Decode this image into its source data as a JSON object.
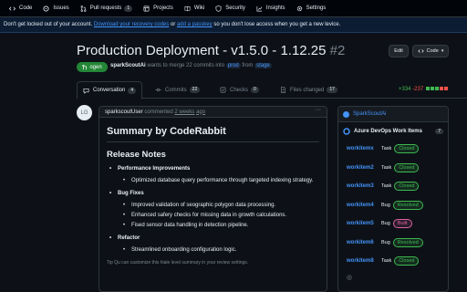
{
  "nav": {
    "items": [
      {
        "label": "Code",
        "icon": "code-icon",
        "count": ""
      },
      {
        "label": "Issues",
        "icon": "issue-icon",
        "count": ""
      },
      {
        "label": "Pull requests",
        "icon": "pull-request-icon",
        "count": "1"
      },
      {
        "label": "Projects",
        "icon": "table-icon",
        "count": ""
      },
      {
        "label": "Wiki",
        "icon": "book-icon",
        "count": ""
      },
      {
        "label": "Security",
        "icon": "shield-icon",
        "count": ""
      },
      {
        "label": "Insights",
        "icon": "graph-icon",
        "count": ""
      },
      {
        "label": "Settings",
        "icon": "gear-icon",
        "count": ""
      }
    ]
  },
  "banner": {
    "text1": "Don't get locked out of your account.",
    "link1": "Download your recovery codes",
    "text2": "or",
    "link2": "add a passkey",
    "text3": "so you don't lose access when you get a new levice."
  },
  "pr": {
    "title": "Production Deployment - v1.5.0 - 1.12.25",
    "number": "#2",
    "edit_label": "Edit",
    "code_label": "Code",
    "state_label": "ogen",
    "author": "sparkScoutAi",
    "merge_text": "wants to merge 22 commits into",
    "base_branch": "prod",
    "from_text": "from",
    "head_branch": "stage"
  },
  "tabs": [
    {
      "label": "Conversation",
      "count": "4",
      "icon": "comment-icon"
    },
    {
      "label": "Commits",
      "count": "22",
      "icon": "commit-icon"
    },
    {
      "label": "Checks",
      "count": "0",
      "icon": "checklist-icon"
    },
    {
      "label": "Files changed",
      "count": "17",
      "icon": "file-diff-icon"
    }
  ],
  "diffstat": {
    "additions": "+334",
    "deletions": "-237"
  },
  "comment": {
    "avatar_initials": "LG",
    "author": "sparkscoutUser",
    "commented": "commented",
    "time": "2 weeks",
    "ago": "ago",
    "summary_title": "Summary by CodeRabbit",
    "notes_title": "Release Notes",
    "sections": [
      {
        "title": "Performance Improvements",
        "items": [
          "Optimized database query performance through targeted indexing strategy."
        ]
      },
      {
        "title": "Bug Fixes",
        "items": [
          "Improved validation of seographic polygon data processing.",
          "Enhanced safery checks for missing data in growth calculations.",
          "Fised sensor data handling in detection pipeline."
        ]
      },
      {
        "title": "Refactor",
        "items": [
          "Streamlined onboarding configuration logic."
        ]
      }
    ],
    "tip": "Tip  Qu can castomize this hiale level summary in your review settings."
  },
  "sidebar": {
    "app_name": "SparkScoutAi",
    "title": "Azure DevOps Work Items",
    "count": "7",
    "items": [
      {
        "id": "workitemx",
        "type": "Task",
        "status": "Closed",
        "color": "#3fb950"
      },
      {
        "id": "workitem2",
        "type": "Task",
        "status": "Closed",
        "color": "#3fb950"
      },
      {
        "id": "workitem3",
        "type": "Task",
        "status": "Closed",
        "color": "#3fb950"
      },
      {
        "id": "workitem4",
        "type": "Bug",
        "status": "Resolved",
        "color": "#3fb950"
      },
      {
        "id": "workitem5",
        "type": "Bug",
        "status": "Built",
        "color": "#db61a2"
      },
      {
        "id": "workitem6",
        "type": "Bug",
        "status": "Resolved",
        "color": "#3fb950"
      },
      {
        "id": "workitem8",
        "type": "Task",
        "status": "Closed",
        "color": "#3fb950"
      }
    ],
    "footer_icon": "circle-icon"
  },
  "colors": {
    "accent": "#4493f8",
    "success": "#238636",
    "bg": "#0d1117"
  }
}
